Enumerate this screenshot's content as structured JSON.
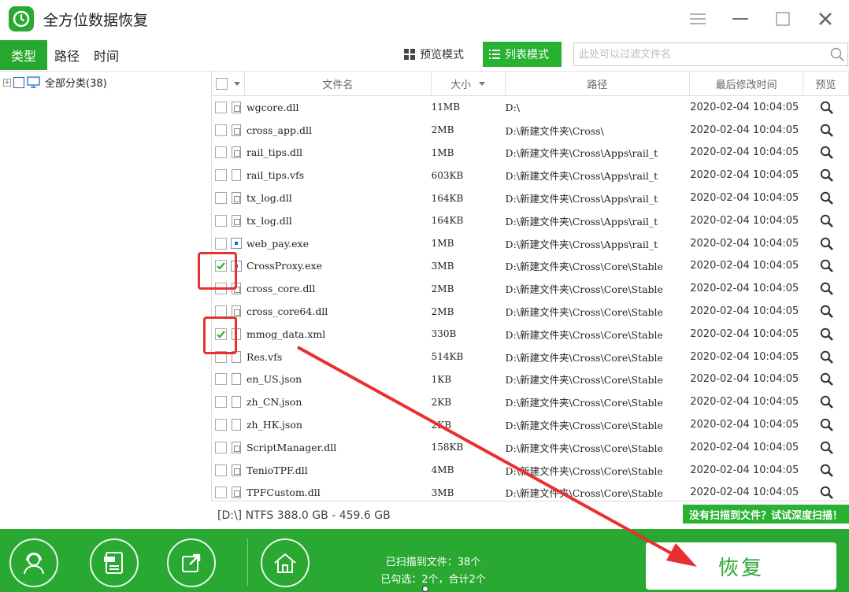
{
  "app": {
    "title": "全方位数据恢复"
  },
  "tabs": [
    {
      "label": "类型",
      "active": true
    },
    {
      "label": "路径",
      "active": false
    },
    {
      "label": "时间",
      "active": false
    }
  ],
  "view": {
    "preview_label": "预览模式",
    "list_label": "列表模式"
  },
  "filter": {
    "placeholder": "此处可以过滤文件名"
  },
  "tree": {
    "root_label": "全部分类(38)"
  },
  "table": {
    "headers": {
      "name": "文件名",
      "size": "大小",
      "path": "路径",
      "time": "最后修改时间",
      "preview": "预览"
    },
    "rows": [
      {
        "name": "wgcore.dll",
        "size": "11MB",
        "path": "D:\\",
        "time": "2020-02-04 10:04:05",
        "checked": false,
        "icon": "dll"
      },
      {
        "name": "cross_app.dll",
        "size": "2MB",
        "path": "D:\\新建文件夹\\Cross\\",
        "time": "2020-02-04 10:04:05",
        "checked": false,
        "icon": "dll"
      },
      {
        "name": "rail_tips.dll",
        "size": "1MB",
        "path": "D:\\新建文件夹\\Cross\\Apps\\rail_t",
        "time": "2020-02-04 10:04:05",
        "checked": false,
        "icon": "dll"
      },
      {
        "name": "rail_tips.vfs",
        "size": "603KB",
        "path": "D:\\新建文件夹\\Cross\\Apps\\rail_t",
        "time": "2020-02-04 10:04:05",
        "checked": false,
        "icon": "file"
      },
      {
        "name": "tx_log.dll",
        "size": "164KB",
        "path": "D:\\新建文件夹\\Cross\\Apps\\rail_t",
        "time": "2020-02-04 10:04:05",
        "checked": false,
        "icon": "dll"
      },
      {
        "name": "tx_log.dll",
        "size": "164KB",
        "path": "D:\\新建文件夹\\Cross\\Apps\\rail_t",
        "time": "2020-02-04 10:04:05",
        "checked": false,
        "icon": "dll"
      },
      {
        "name": "web_pay.exe",
        "size": "1MB",
        "path": "D:\\新建文件夹\\Cross\\Apps\\rail_t",
        "time": "2020-02-04 10:04:05",
        "checked": false,
        "icon": "exe"
      },
      {
        "name": "CrossProxy.exe",
        "size": "3MB",
        "path": "D:\\新建文件夹\\Cross\\Core\\Stable",
        "time": "2020-02-04 10:04:05",
        "checked": true,
        "icon": "exe"
      },
      {
        "name": "cross_core.dll",
        "size": "2MB",
        "path": "D:\\新建文件夹\\Cross\\Core\\Stable",
        "time": "2020-02-04 10:04:05",
        "checked": false,
        "icon": "dll"
      },
      {
        "name": "cross_core64.dll",
        "size": "2MB",
        "path": "D:\\新建文件夹\\Cross\\Core\\Stable",
        "time": "2020-02-04 10:04:05",
        "checked": false,
        "icon": "dll"
      },
      {
        "name": "mmog_data.xml",
        "size": "330B",
        "path": "D:\\新建文件夹\\Cross\\Core\\Stable",
        "time": "2020-02-04 10:04:05",
        "checked": true,
        "icon": "file"
      },
      {
        "name": "Res.vfs",
        "size": "514KB",
        "path": "D:\\新建文件夹\\Cross\\Core\\Stable",
        "time": "2020-02-04 10:04:05",
        "checked": false,
        "icon": "file"
      },
      {
        "name": "en_US.json",
        "size": "1KB",
        "path": "D:\\新建文件夹\\Cross\\Core\\Stable",
        "time": "2020-02-04 10:04:05",
        "checked": false,
        "icon": "file"
      },
      {
        "name": "zh_CN.json",
        "size": "2KB",
        "path": "D:\\新建文件夹\\Cross\\Core\\Stable",
        "time": "2020-02-04 10:04:05",
        "checked": false,
        "icon": "file"
      },
      {
        "name": "zh_HK.json",
        "size": "2KB",
        "path": "D:\\新建文件夹\\Cross\\Core\\Stable",
        "time": "2020-02-04 10:04:05",
        "checked": false,
        "icon": "file"
      },
      {
        "name": "ScriptManager.dll",
        "size": "158KB",
        "path": "D:\\新建文件夹\\Cross\\Core\\Stable",
        "time": "2020-02-04 10:04:05",
        "checked": false,
        "icon": "dll"
      },
      {
        "name": "TenioTPF.dll",
        "size": "4MB",
        "path": "D:\\新建文件夹\\Cross\\Core\\Stable",
        "time": "2020-02-04 10:04:05",
        "checked": false,
        "icon": "dll"
      },
      {
        "name": "TPFCustom.dll",
        "size": "3MB",
        "path": "D:\\新建文件夹\\Cross\\Core\\Stable",
        "time": "2020-02-04 10:04:05",
        "checked": false,
        "icon": "dll"
      }
    ]
  },
  "status": {
    "drive_info": "[D:\\] NTFS 388.0 GB - 459.6 GB",
    "deep_scan_label": "没有扫描到文件？试试深度扫描！"
  },
  "bottom": {
    "scanned_text": "已扫描到文件：38个",
    "selected_text": "已勾选：2个，合计2个",
    "recover_label": "恢复"
  },
  "colors": {
    "accent": "#28b232",
    "highlight": "#e83030"
  }
}
